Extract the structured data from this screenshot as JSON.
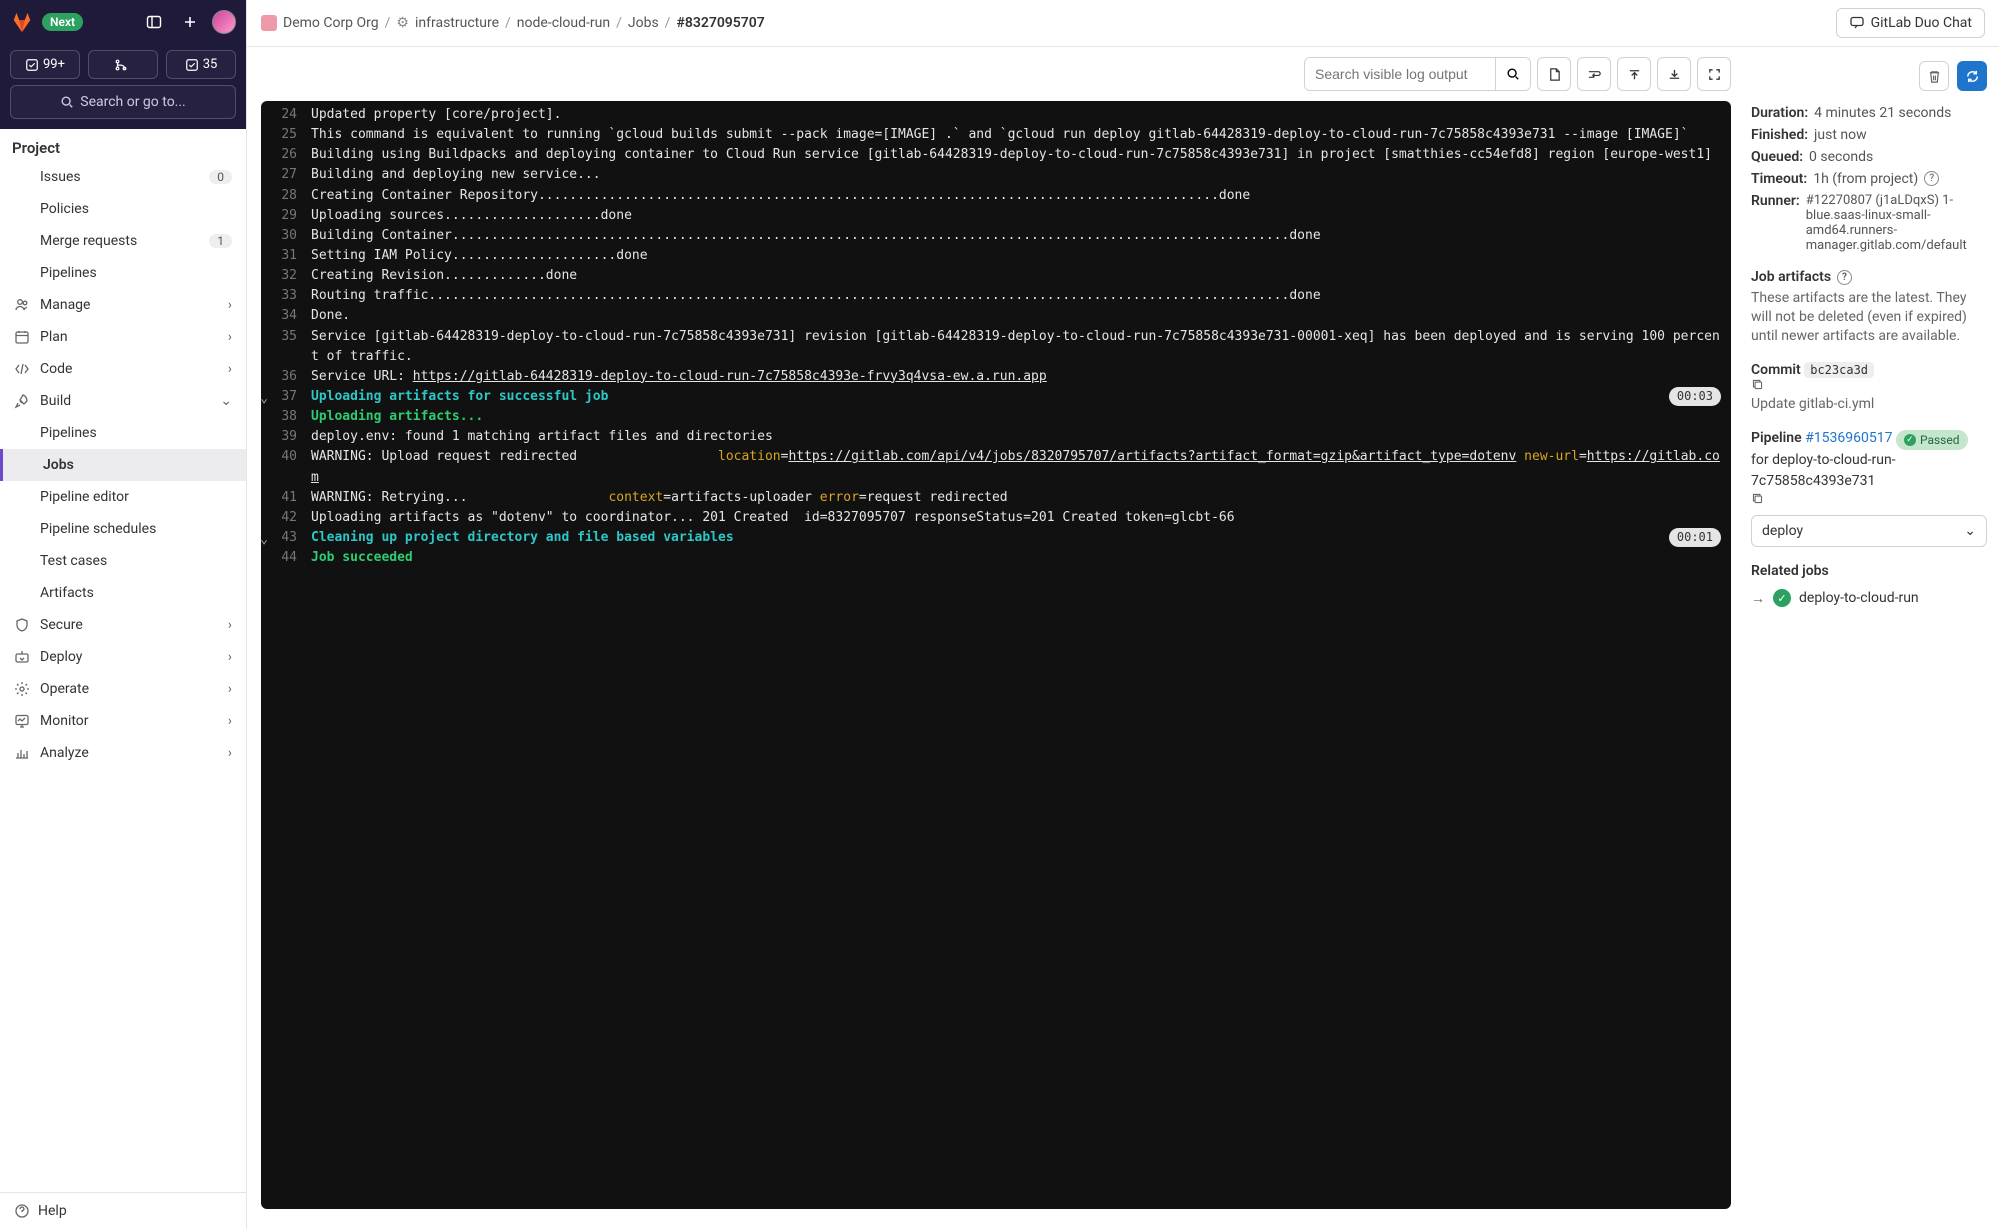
{
  "header": {
    "next_badge": "Next",
    "counts": {
      "todos": "99+",
      "merge": "",
      "reviews": "35"
    },
    "search_label": "Search or go to..."
  },
  "breadcrumbs": {
    "org": "Demo Corp Org",
    "group": "infrastructure",
    "project": "node-cloud-run",
    "section": "Jobs",
    "id": "#8327095707"
  },
  "duo_chat": "GitLab Duo Chat",
  "sidebar": {
    "section": "Project",
    "items": {
      "issues": "Issues",
      "issues_badge": "0",
      "policies": "Policies",
      "merge": "Merge requests",
      "merge_badge": "1",
      "pipelines": "Pipelines",
      "manage": "Manage",
      "plan": "Plan",
      "code": "Code",
      "build": "Build",
      "build_pipelines": "Pipelines",
      "build_jobs": "Jobs",
      "build_editor": "Pipeline editor",
      "build_schedules": "Pipeline schedules",
      "build_tests": "Test cases",
      "build_artifacts": "Artifacts",
      "secure": "Secure",
      "deploy": "Deploy",
      "operate": "Operate",
      "monitor": "Monitor",
      "analyze": "Analyze"
    },
    "help": "Help"
  },
  "log_toolbar": {
    "search_placeholder": "Search visible log output"
  },
  "log": [
    {
      "n": "24",
      "t": "Updated property [core/project]."
    },
    {
      "n": "25",
      "t": "This command is equivalent to running `gcloud builds submit --pack image=[IMAGE] .` and `gcloud run deploy gitlab-64428319-deploy-to-cloud-run-7c75858c4393e731 --image [IMAGE]`"
    },
    {
      "n": "26",
      "t": "Building using Buildpacks and deploying container to Cloud Run service [gitlab-64428319-deploy-to-cloud-run-7c75858c4393e731] in project [smatthies-cc54efd8] region [europe-west1]"
    },
    {
      "n": "27",
      "t": "Building and deploying new service..."
    },
    {
      "n": "28",
      "t": "Creating Container Repository.......................................................................................done"
    },
    {
      "n": "29",
      "t": "Uploading sources....................done"
    },
    {
      "n": "30",
      "t": "Building Container...........................................................................................................done"
    },
    {
      "n": "31",
      "t": "Setting IAM Policy.....................done"
    },
    {
      "n": "32",
      "t": "Creating Revision.............done"
    },
    {
      "n": "33",
      "t": "Routing traffic..............................................................................................................done"
    },
    {
      "n": "34",
      "t": "Done."
    },
    {
      "n": "35",
      "t": "Service [gitlab-64428319-deploy-to-cloud-run-7c75858c4393e731] revision [gitlab-64428319-deploy-to-cloud-run-7c75858c4393e731-00001-xeq] has been deployed and is serving 100 percent of traffic."
    },
    {
      "n": "36",
      "pre": "Service URL: ",
      "link": "https://gitlab-64428319-deploy-to-cloud-run-7c75858c4393e-frvy3q4vsa-ew.a.run.app"
    },
    {
      "n": "37",
      "t": "Uploading artifacts for successful job",
      "cls": "cyan",
      "collapse": true,
      "dur": "00:03"
    },
    {
      "n": "38",
      "t": "Uploading artifacts...",
      "cls": "green"
    },
    {
      "n": "39",
      "t": "deploy.env: found 1 matching artifact files and directories"
    },
    {
      "n": "40",
      "warn": "WARNING: Upload request redirected",
      "p1k": "location",
      "p1v": "https://gitlab.com/api/v4/jobs/8320795707/artifacts?artifact_format=gzip&artifact_type=dotenv",
      "p2k": "new-url",
      "p2v": "https://gitlab.com"
    },
    {
      "n": "41",
      "warn": "WARNING: Retrying...",
      "p1k": "context",
      "p1t": "artifacts-uploader",
      "p2k": "error",
      "p2t": "request redirected"
    },
    {
      "n": "42",
      "t": "Uploading artifacts as \"dotenv\" to coordinator... 201 Created  id=8327095707 responseStatus=201 Created token=glcbt-66"
    },
    {
      "n": "43",
      "t": "Cleaning up project directory and file based variables",
      "cls": "cyan",
      "collapse": true,
      "dur": "00:01"
    },
    {
      "n": "44",
      "t": "Job succeeded",
      "cls": "green"
    }
  ],
  "right": {
    "duration_k": "Duration:",
    "duration_v": "4 minutes 21 seconds",
    "finished_k": "Finished:",
    "finished_v": "just now",
    "queued_k": "Queued:",
    "queued_v": "0 seconds",
    "timeout_k": "Timeout:",
    "timeout_v": "1h (from project)",
    "runner_k": "Runner:",
    "runner_v": "#12270807 (j1aLDqxS) 1-blue.saas-linux-small-amd64.runners-manager.gitlab.com/default",
    "artifacts_h": "Job artifacts",
    "artifacts_desc": "These artifacts are the latest. They will not be deleted (even if expired) until newer artifacts are available.",
    "commit_label": "Commit",
    "commit_sha": "bc23ca3d",
    "commit_msg": "Update gitlab-ci.yml",
    "pipeline_label": "Pipeline",
    "pipeline_id": "#1536960517",
    "passed": "Passed",
    "pipeline_for": "for deploy-to-cloud-run-7c75858c4393e731",
    "stage_select": "deploy",
    "related_h": "Related jobs",
    "related_job": "deploy-to-cloud-run"
  }
}
